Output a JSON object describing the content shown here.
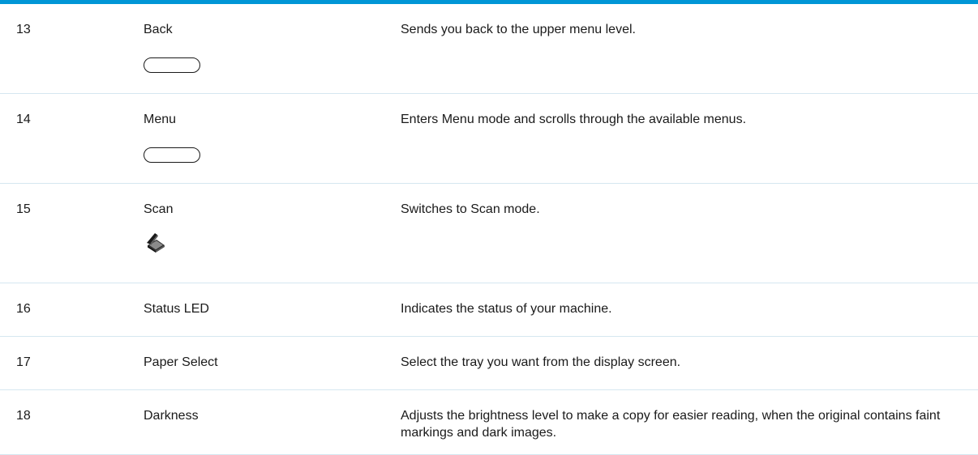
{
  "rows": [
    {
      "number": "13",
      "name": "Back",
      "description": "Sends you back to the upper menu level.",
      "icon": "oval-button-icon"
    },
    {
      "number": "14",
      "name": "Menu",
      "description": "Enters Menu mode and scrolls through the available menus.",
      "icon": "oval-button-icon"
    },
    {
      "number": "15",
      "name": "Scan",
      "description": "Switches to Scan mode.",
      "icon": "scanner-icon"
    },
    {
      "number": "16",
      "name": "Status LED",
      "description": "Indicates the status of your machine."
    },
    {
      "number": "17",
      "name": "Paper Select",
      "description": "Select the tray you want from the display screen."
    },
    {
      "number": "18",
      "name": "Darkness",
      "description": "Adjusts the brightness level to make a copy for easier reading, when the original contains faint markings and dark images."
    }
  ],
  "colors": {
    "accent_rule": "#0096d6",
    "row_divider": "#d5e7f0",
    "text": "#1a1a1a"
  }
}
